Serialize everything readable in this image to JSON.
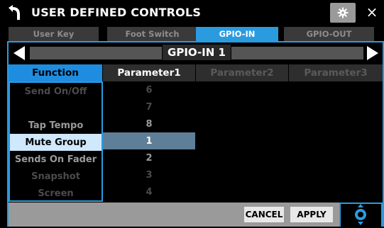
{
  "header": {
    "title": "USER DEFINED CONTROLS",
    "back_icon": "back-arrow-icon",
    "settings_icon": "gear-icon",
    "close_label": "×"
  },
  "tabs": [
    {
      "label": "User Key",
      "active": false
    },
    {
      "label": "Foot Switch",
      "active": false
    },
    {
      "label": "GPIO-IN",
      "active": true
    },
    {
      "label": "GPIO-OUT",
      "active": false
    }
  ],
  "selector": {
    "title": "GPIO-IN 1",
    "prev_icon": "left-triangle-icon",
    "next_icon": "right-triangle-icon"
  },
  "columns": {
    "function": "Function",
    "parameter1": "Parameter1",
    "parameter2": "Parameter2",
    "parameter3": "Parameter3"
  },
  "functions": [
    {
      "label": "Send On/Off",
      "state": "dim"
    },
    {
      "label": "",
      "state": "dim"
    },
    {
      "label": "Tap Tempo",
      "state": "mid"
    },
    {
      "label": "Mute Group",
      "state": "selected"
    },
    {
      "label": "Sends On Fader",
      "state": "mid"
    },
    {
      "label": "Snapshot",
      "state": "dim"
    },
    {
      "label": "Screen",
      "state": "dim"
    }
  ],
  "parameter1_values": [
    {
      "label": "6",
      "state": "dim"
    },
    {
      "label": "7",
      "state": "dim"
    },
    {
      "label": "8",
      "state": "mid"
    },
    {
      "label": "1",
      "state": "selected"
    },
    {
      "label": "2",
      "state": "mid"
    },
    {
      "label": "3",
      "state": "dim"
    },
    {
      "label": "4",
      "state": "dim"
    }
  ],
  "footer": {
    "cancel_label": "CANCEL",
    "apply_label": "APPLY",
    "knob_icon": "encoder-knob-icon"
  },
  "colors": {
    "accent": "#2b9be0",
    "selected_function_bg": "#cfe8fb",
    "selected_param_bg": "#5f7f98"
  }
}
